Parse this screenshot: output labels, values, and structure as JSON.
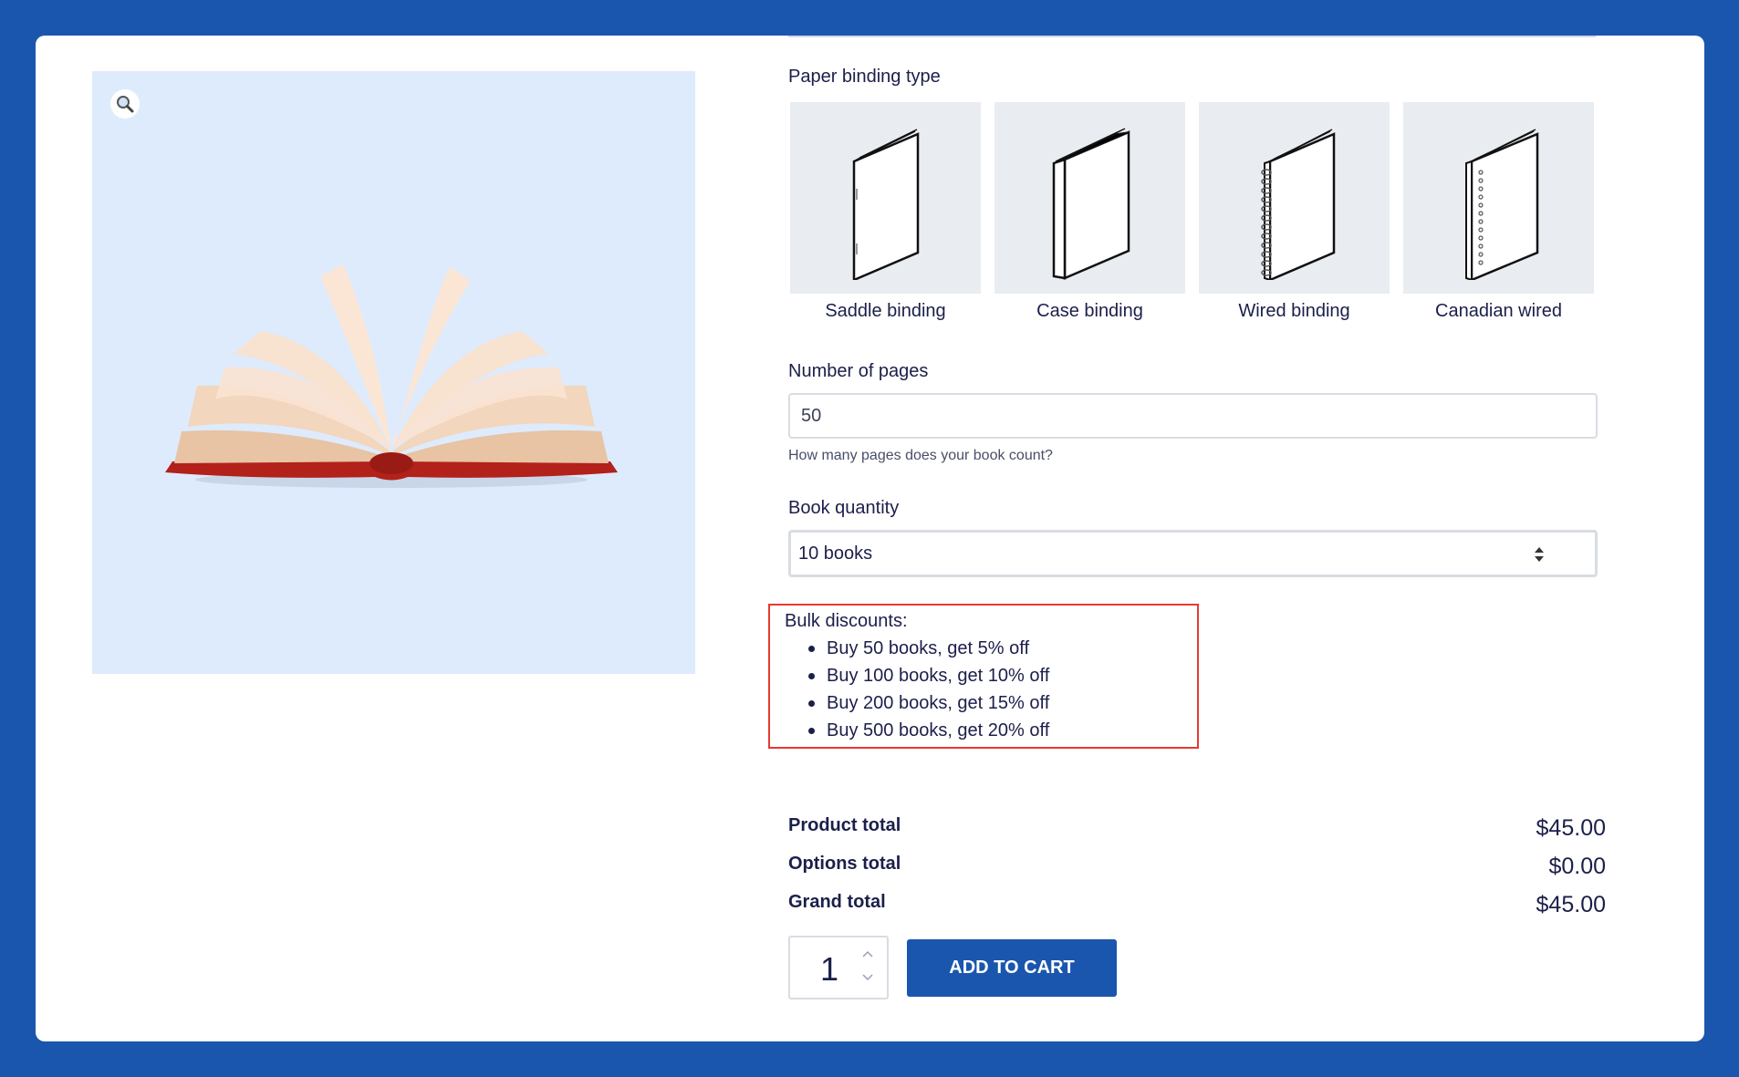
{
  "options": {
    "binding": {
      "label": "Paper binding type",
      "items": [
        {
          "name": "Saddle binding",
          "icon": "saddle-binding-icon"
        },
        {
          "name": "Case binding",
          "icon": "case-binding-icon"
        },
        {
          "name": "Wired binding",
          "icon": "wired-binding-icon"
        },
        {
          "name": "Canadian wired",
          "icon": "canadian-wired-icon"
        }
      ]
    },
    "pages": {
      "label": "Number of pages",
      "value": "50",
      "help": "How many pages does your book count?"
    },
    "quantity": {
      "label": "Book quantity",
      "value": "10 books"
    }
  },
  "discounts": {
    "title": "Bulk discounts:",
    "items": [
      "Buy 50 books, get 5% off",
      "Buy 100 books, get 10% off",
      "Buy 200 books, get 15% off",
      "Buy 500 books, get 20% off"
    ],
    "highlight_color": "#e53a32"
  },
  "totals": {
    "product_label": "Product total",
    "product_value": "$45.00",
    "options_label": "Options total",
    "options_value": "$0.00",
    "grand_label": "Grand total",
    "grand_value": "$45.00"
  },
  "cart": {
    "quantity": "1",
    "button_label": "ADD TO CART"
  },
  "colors": {
    "brand": "#1a56ad",
    "text": "#1b1f4a",
    "image_bg": "#deebfc"
  }
}
